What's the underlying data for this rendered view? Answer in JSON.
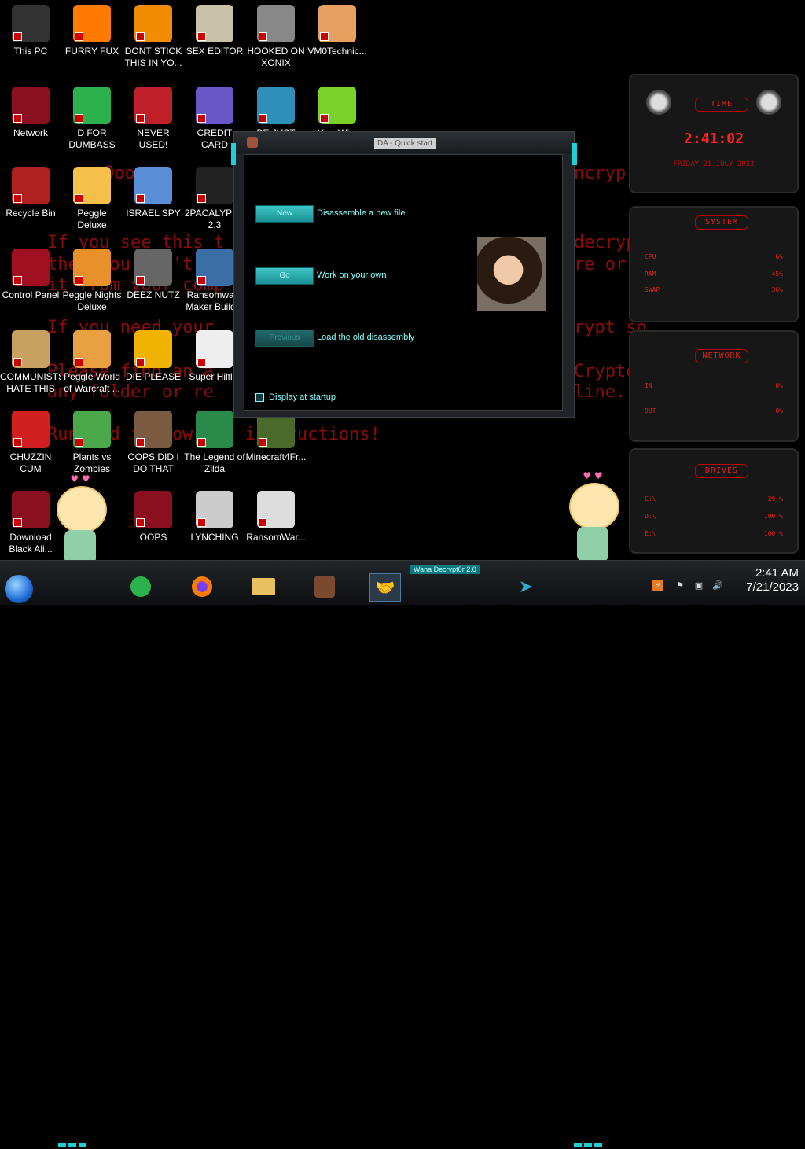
{
  "ransom_text": {
    "lines": [
      "Ooops,",
      "If you see this t",
      "then you can't",
      "it from your comp",
      "If you need your",
      "Please find an a",
      "any folder or re",
      "Run and follow the instructions!",
      "ncryp",
      "decrypt",
      "re or",
      "rypt so",
      "Cryptoc",
      "line."
    ]
  },
  "desktop_icons": [
    {
      "label": "This PC",
      "icon": "computer-icon",
      "color": "#333"
    },
    {
      "label": "FURRY FUX",
      "icon": "firefox-icon",
      "color": "#ff7a00"
    },
    {
      "label": "DONT STICK THIS IN YO...",
      "icon": "vlc-cone-icon",
      "color": "#f28c00"
    },
    {
      "label": "SEX EDITOR",
      "icon": "hex-editor-icon",
      "color": "#c9c2a8"
    },
    {
      "label": "HOOKED ON XONIX",
      "icon": "xonix-game-icon",
      "color": "#888"
    },
    {
      "label": "VM0Technic...",
      "icon": "doctor-icon",
      "color": "#e8a060"
    },
    {
      "label": "Network",
      "icon": "network-globe-icon",
      "color": "#8a1020"
    },
    {
      "label": "D FOR DUMBASS",
      "icon": "feedly-icon",
      "color": "#2bb24c"
    },
    {
      "label": "NEVER USED!",
      "icon": "dev-cpp-icon",
      "color": "#c0202a"
    },
    {
      "label": "CREDIT CARD CHECKE...",
      "icon": "credit-card-icon",
      "color": "#6a58c9"
    },
    {
      "label": "BE JUST LIKE ...",
      "icon": "gnome-icon",
      "color": "#2e8fb8"
    },
    {
      "label": "YoyoWi...",
      "icon": "lime-icon",
      "color": "#7ad12a"
    },
    {
      "label": "Recycle Bin",
      "icon": "recycle-bin-icon",
      "color": "#b02020"
    },
    {
      "label": "Peggle Deluxe",
      "icon": "peggle-icon",
      "color": "#f5c04a"
    },
    {
      "label": "ISRAEL SPY",
      "icon": "spy-screen-icon",
      "color": "#5a8fd8"
    },
    {
      "label": "2PACALYPSE 2.3",
      "icon": "terminal-icon",
      "color": "#222"
    },
    {
      "label": "Control Panel",
      "icon": "control-panel-icon",
      "color": "#a01020"
    },
    {
      "label": "Peggle Nights Deluxe",
      "icon": "peggle-nights-icon",
      "color": "#e8902a"
    },
    {
      "label": "DEEZ NUTZ",
      "icon": "stacked-windows-icon",
      "color": "#666"
    },
    {
      "label": "Ransomware Maker Build...",
      "icon": "builder-window-icon",
      "color": "#3a6ea5"
    },
    {
      "label": "COMMUNISTS HATE THIS G...",
      "icon": "money-bag-icon",
      "color": "#c8a060"
    },
    {
      "label": "Peggle World of Warcraft ...",
      "icon": "peggle-wow-icon",
      "color": "#e8a040"
    },
    {
      "label": "DIE PLEASE",
      "icon": "de-icon",
      "color": "#f0b400"
    },
    {
      "label": "Super Hiltl...",
      "icon": "pixel-dog-icon",
      "color": "#eee"
    },
    {
      "label": "CHUZZIN CUM",
      "icon": "chuzzle-icon",
      "color": "#d02020"
    },
    {
      "label": "Plants vs Zombies",
      "icon": "plant-icon",
      "color": "#4aa84a"
    },
    {
      "label": "OOPS DID I DO THAT",
      "icon": "portrait-icon",
      "color": "#7a5a40"
    },
    {
      "label": "The Legend of Zilda",
      "icon": "zilda-icon",
      "color": "#2a8a4a"
    },
    {
      "label": "Minecraft4Fr...",
      "icon": "minecraft-icon",
      "color": "#4a6a2a"
    },
    {
      "label": "Download Black Ali...",
      "icon": "alien-globe-icon",
      "color": "#8a1020"
    },
    {
      "label": "OOPS",
      "icon": "oops-icon",
      "color": "#8a1020"
    },
    {
      "label": "LYNCHING",
      "icon": "rope-icon",
      "color": "#ccc"
    },
    {
      "label": "RansomWar...",
      "icon": "skull-icon",
      "color": "#ddd"
    }
  ],
  "dialog": {
    "title": "DA - Quick start",
    "buttons": [
      {
        "label": "New",
        "description": "Disassemble a new file",
        "enabled": true
      },
      {
        "label": "Go",
        "description": "Work on your own",
        "enabled": true
      },
      {
        "label": "Previous",
        "description": "Load the old disassembly",
        "enabled": false
      }
    ],
    "checkbox_label": "Display at startup",
    "checkbox_checked": true
  },
  "widgets": {
    "time": {
      "title": "TIME",
      "clock": "2:41:02",
      "date": "FRIDAY 21 JULY 2023"
    },
    "system": {
      "title": "SYSTEM",
      "rows": [
        {
          "label": "CPU",
          "value": "6%"
        },
        {
          "label": "RAM",
          "value": "45%"
        },
        {
          "label": "SWAP",
          "value": "36%"
        }
      ]
    },
    "network": {
      "title": "NETWORK",
      "rows": [
        {
          "label": "IN",
          "value": "0%"
        },
        {
          "label": "OUT",
          "value": "0%"
        }
      ]
    },
    "drives": {
      "title": "DRIVES",
      "rows": [
        {
          "label": "C:\\",
          "value": "29 %"
        },
        {
          "label": "D:\\",
          "value": "100 %"
        },
        {
          "label": "E:\\",
          "value": "100 %"
        }
      ]
    }
  },
  "taskbar": {
    "apps": [
      {
        "name": "feedly-taskbar",
        "icon": "feedly-icon"
      },
      {
        "name": "firefox-taskbar",
        "icon": "firefox-icon"
      },
      {
        "name": "file-explorer-taskbar",
        "icon": "folder-icon"
      },
      {
        "name": "portrait-app-taskbar",
        "icon": "portrait-icon"
      },
      {
        "name": "handshake-app-taskbar",
        "icon": "handshake-icon",
        "active": true
      },
      {
        "name": "arrow-app-taskbar",
        "icon": "arrow-icon"
      }
    ],
    "tooltip": "Wana Decrypt0r 2.0",
    "clock_time": "2:41 AM",
    "clock_date": "7/21/2023"
  }
}
